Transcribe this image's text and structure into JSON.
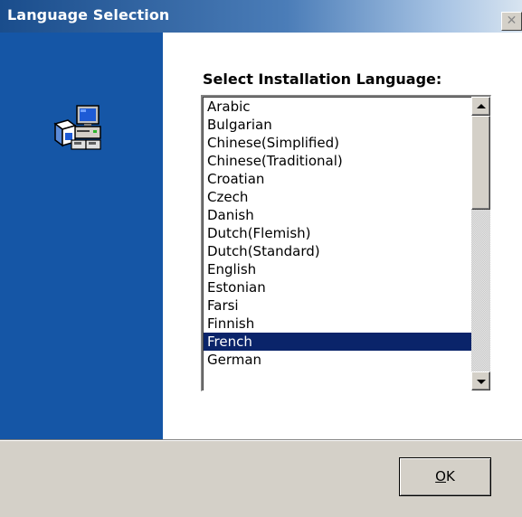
{
  "window": {
    "title": "Language Selection",
    "close_label": "✕"
  },
  "prompt": "Select Installation Language:",
  "languages": [
    "Arabic",
    "Bulgarian",
    "Chinese(Simplified)",
    "Chinese(Traditional)",
    "Croatian",
    "Czech",
    "Danish",
    "Dutch(Flemish)",
    "Dutch(Standard)",
    "English",
    "Estonian",
    "Farsi",
    "Finnish",
    "French",
    "German"
  ],
  "selected_language": "French",
  "ok_button": {
    "mnemonic": "O",
    "rest": "K"
  },
  "icons": {
    "installer": "computer-setup-icon",
    "scroll_up": "arrow-up-icon",
    "scroll_down": "arrow-down-icon",
    "close": "close-icon"
  },
  "colors": {
    "side_panel": "#1556a6",
    "selection": "#0a246a",
    "face": "#d4d0c8"
  }
}
